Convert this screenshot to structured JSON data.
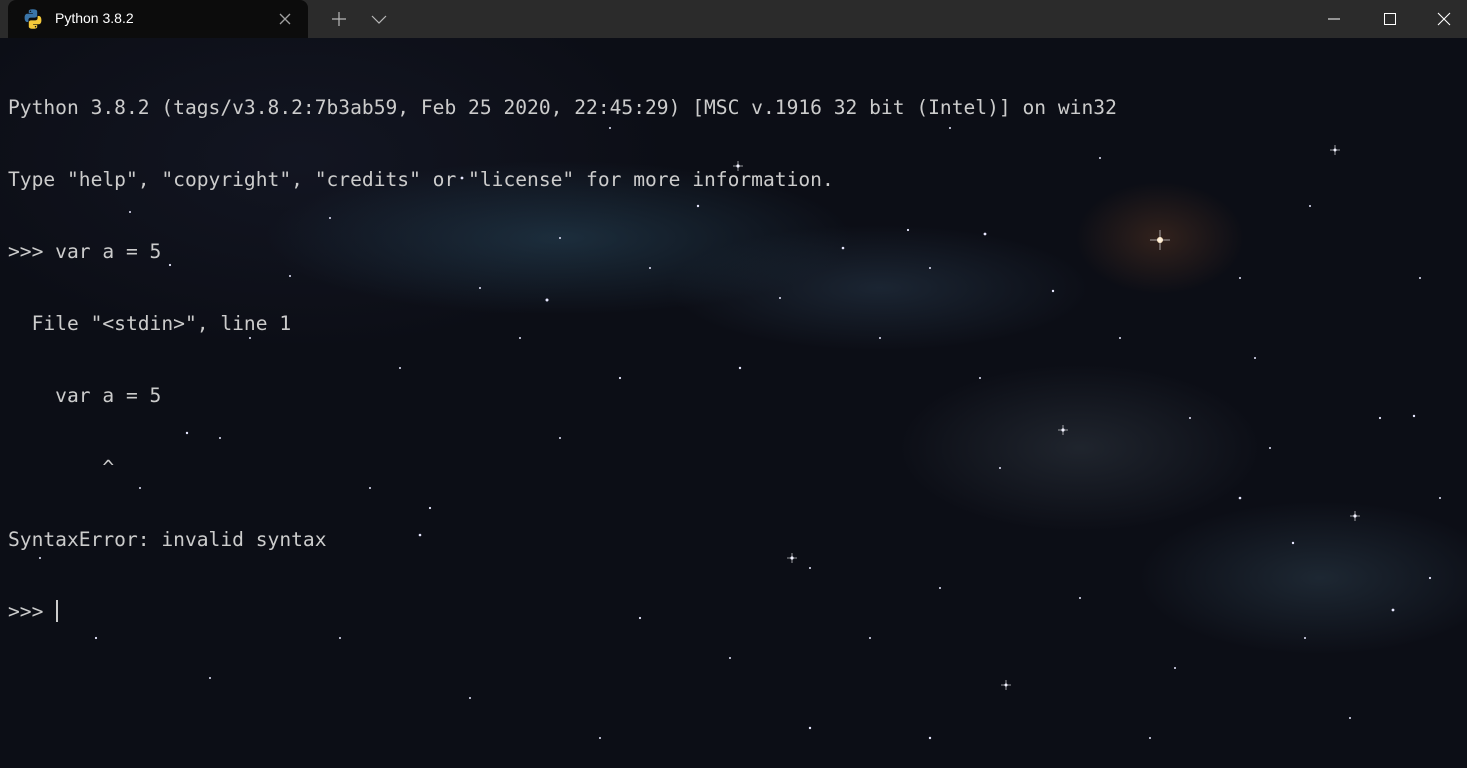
{
  "tab": {
    "title": "Python 3.8.2",
    "icon": "python-logo-icon",
    "close_icon": "close-icon"
  },
  "titlebar": {
    "new_tab_icon": "plus-icon",
    "dropdown_icon": "chevron-down-icon",
    "minimize_icon": "minimize-icon",
    "maximize_icon": "maximize-icon",
    "close_icon": "close-icon"
  },
  "console": {
    "lines": [
      "Python 3.8.2 (tags/v3.8.2:7b3ab59, Feb 25 2020, 22:45:29) [MSC v.1916 32 bit (Intel)] on win32",
      "Type \"help\", \"copyright\", \"credits\" or \"license\" for more information.",
      ">>> var a = 5",
      "  File \"<stdin>\", line 1",
      "    var a = 5",
      "        ^",
      "SyntaxError: invalid syntax"
    ],
    "prompt": ">>> "
  },
  "colors": {
    "titlebar": "#2b2b2b",
    "active_tab": "#0c0c0c",
    "text": "#cccccc",
    "background": "#0c0e16",
    "python_blue": "#3a75a8",
    "python_yellow": "#f5c93a"
  }
}
